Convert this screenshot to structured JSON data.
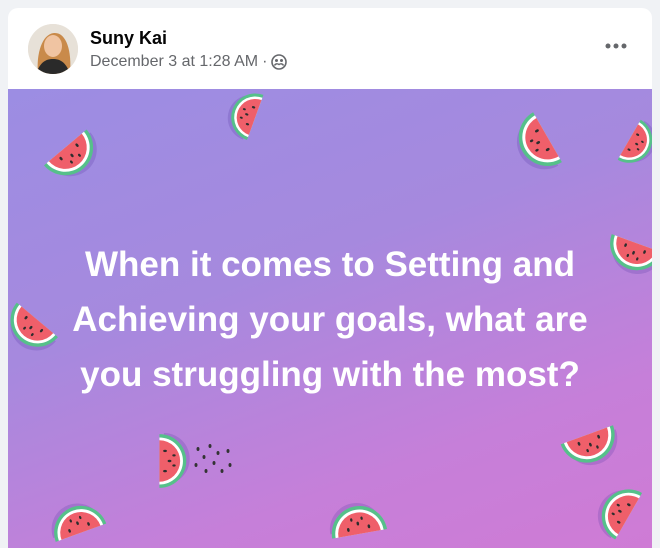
{
  "post": {
    "author": "Suny Kai",
    "timestamp": "December 3 at 1:28 AM",
    "separator": "·",
    "audience_icon": "friends-icon",
    "more_icon": "more-dots-icon",
    "text_lines": [
      "When it comes to Setting and",
      "Achieving your goals, what are",
      "you struggling with the most?"
    ],
    "background": {
      "gradient_colors": [
        "#9c8de3",
        "#a689de",
        "#c67fd9",
        "#cf7bd5"
      ],
      "decoration": "watermelon-slices"
    }
  },
  "colors": {
    "name": "#050505",
    "meta": "#65676b",
    "post_text": "#ffffff",
    "melon_flesh": "#ef5f6a",
    "melon_rind": "#6fcf97",
    "melon_white": "#ffffff"
  }
}
